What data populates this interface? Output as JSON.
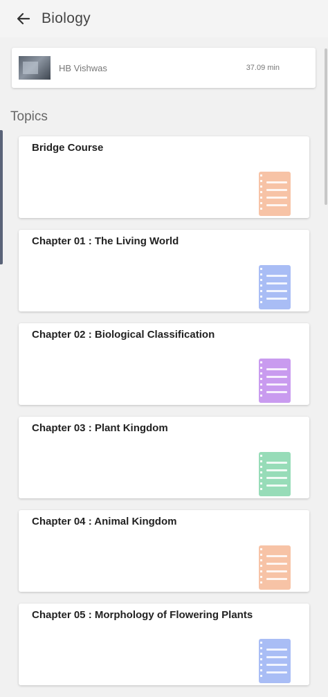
{
  "app_bar": {
    "title": "Biology",
    "back_icon": "arrow-left-icon"
  },
  "author": {
    "name": "HB Vishwas",
    "duration": "37.09 min"
  },
  "section_label": "Topics",
  "topics": [
    {
      "title": "Bridge Course",
      "icon_color": "#f7c3a6"
    },
    {
      "title": "Chapter 01 : The Living World",
      "icon_color": "#a9bdf5"
    },
    {
      "title": "Chapter 02 : Biological Classification",
      "icon_color": "#c99bef"
    },
    {
      "title": "Chapter 03 : Plant Kingdom",
      "icon_color": "#97dcb8"
    },
    {
      "title": "Chapter 04 : Animal Kingdom",
      "icon_color": "#f7c3a6"
    },
    {
      "title": "Chapter 05 : Morphology of Flowering Plants",
      "icon_color": "#a9bdf5"
    }
  ]
}
